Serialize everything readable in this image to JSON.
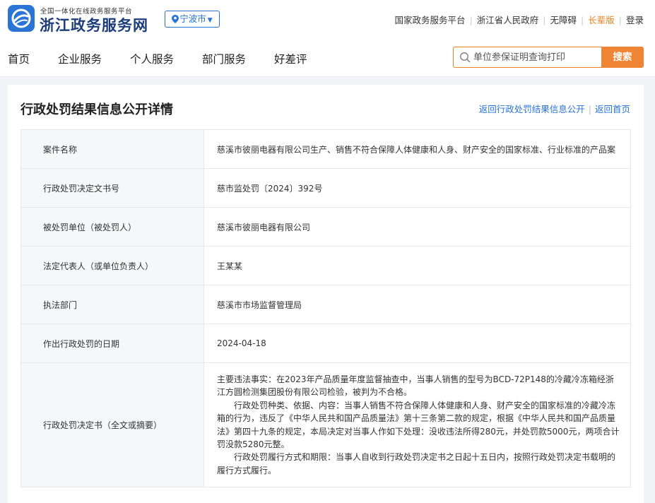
{
  "header": {
    "logo_tagline": "全国一体化在线政务服务平台",
    "logo_title": "浙江政务服务网",
    "city": "宁波市",
    "top_links": [
      {
        "label": "国家政务服务平台"
      },
      {
        "label": "浙江省人民政府"
      },
      {
        "label": "无障碍"
      },
      {
        "label": "长辈版",
        "highlight": true
      },
      {
        "label": "登录"
      }
    ],
    "highlight_color": "#e8801f",
    "brand_color": "#2a74d5"
  },
  "nav": {
    "items": [
      "首页",
      "企业服务",
      "个人服务",
      "部门服务",
      "好差评"
    ],
    "search_placeholder": "单位参保证明查询打印",
    "search_button": "搜索",
    "search_color": "#ee8434"
  },
  "main": {
    "title": "行政处罚结果信息公开详情",
    "links": [
      "返回行政处罚结果信息公开",
      "返回首页"
    ],
    "rows": [
      {
        "label": "案件名称",
        "value": "慈溪市彼丽电器有限公司生产、销售不符合保障人体健康和人身、财产安全的国家标准、行业标准的产品案"
      },
      {
        "label": "行政处罚决定文书号",
        "value": "慈市监处罚〔2024〕392号"
      },
      {
        "label": "被处罚单位（被处罚人）",
        "value": "慈溪市彼丽电器有限公司"
      },
      {
        "label": "法定代表人（或单位负责人）",
        "value": "王某某"
      },
      {
        "label": "执法部门",
        "value": "慈溪市市场监督管理局"
      },
      {
        "label": "作出行政处罚的日期",
        "value": "2024-04-18"
      }
    ],
    "decision": {
      "label": "行政处罚决定书（全文或摘要）",
      "paragraphs": [
        "主要违法事实：在2023年产品质量年度监督抽查中，当事人销售的型号为BCD-72P148的冷藏冷冻箱经浙江方圆检测集团股份有限公司检验，被判为不合格。",
        "行政处罚种类、依据、内容：当事人销售不符合保障人体健康和人身、财产安全的国家标准的冷藏冷冻箱的行为，违反了《中华人民共和国产品质量法》第十三条第二款的规定，根据《中华人民共和国产品质量法》第四十九条的规定，本局决定对当事人作如下处理：没收违法所得280元，并处罚款5000元，两项合计罚没款5280元整。",
        "行政处罚履行方式和期限：当事人自收到行政处罚决定书之日起十五日内，按照行政处罚决定书载明的履行方式履行。"
      ]
    }
  }
}
